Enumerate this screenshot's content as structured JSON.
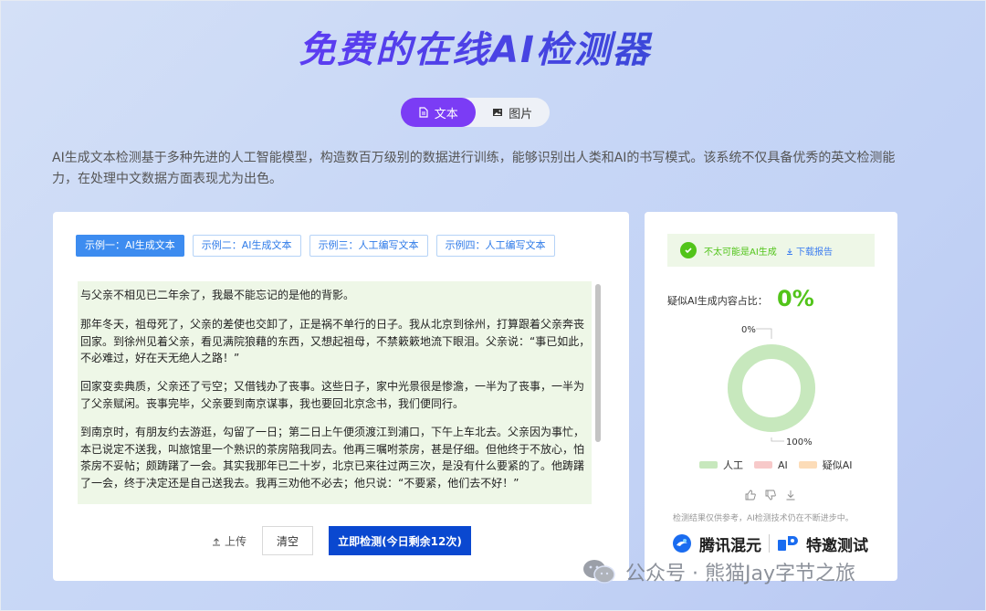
{
  "header": {
    "title": "免费的在线AI检测器"
  },
  "mode_tabs": [
    {
      "label": "文本",
      "icon": "document-icon",
      "active": true
    },
    {
      "label": "图片",
      "icon": "image-icon",
      "active": false
    }
  ],
  "intro_text": "AI生成文本检测基于多种先进的人工智能模型，构造数百万级别的数据进行训练，能够识别出人类和AI的书写模式。该系统不仅具备优秀的英文检测能力，在处理中文数据方面表现尤为出色。",
  "examples": [
    {
      "label": "示例一：AI生成文本",
      "active": true
    },
    {
      "label": "示例二：AI生成文本",
      "active": false
    },
    {
      "label": "示例三：人工编写文本",
      "active": false
    },
    {
      "label": "示例四：人工编写文本",
      "active": false
    }
  ],
  "input_text": {
    "p1": "与父亲不相见已二年余了，我最不能忘记的是他的背影。",
    "p2": "那年冬天，祖母死了，父亲的差使也交卸了，正是祸不单行的日子。我从北京到徐州，打算跟着父亲奔丧回家。到徐州见着父亲，看见满院狼藉的东西，又想起祖母，不禁簌簌地流下眼泪。父亲说：“事已如此，不必难过，好在天无绝人之路！”",
    "p3": "回家变卖典质，父亲还了亏空；又借钱办了丧事。这些日子，家中光景很是惨澹，一半为了丧事，一半为了父亲赋闲。丧事完毕，父亲要到南京谋事，我也要回北京念书，我们便同行。",
    "p4": "到南京时，有朋友约去游逛，勾留了一日；第二日上午便须渡江到浦口，下午上车北去。父亲因为事忙，本已说定不送我，叫旅馆里一个熟识的茶房陪我同去。他再三嘱咐茶房，甚是仔细。但他终于不放心，怕茶房不妥帖；颇踌躇了一会。其实我那年已二十岁，北京已来往过两三次，是没有什么要紧的了。他踌躇了一会，终于决定还是自己送我去。我再三劝他不必去；他只说：“不要紧，他们去不好！”"
  },
  "actions": {
    "upload_label": "上传",
    "clear_label": "清空",
    "detect_label": "立即检测(今日剩余12次)"
  },
  "result": {
    "status_text": "不太可能是AI生成",
    "download_label": "下载报告",
    "ratio_label": "疑似AI生成内容占比：",
    "ratio_value": "0%",
    "disclaimer": "检测结果仅供参考，AI检测技术仍在不断进步中。"
  },
  "chart_data": {
    "type": "pie",
    "categories": [
      "人工",
      "AI",
      "疑似AI"
    ],
    "values": [
      100,
      0,
      0
    ],
    "annotations": [
      "0%",
      "100%"
    ],
    "colors": {
      "人工": "#c7e8bd",
      "AI": "#f7c9c9",
      "疑似AI": "#fcdcb8"
    },
    "legend": "bottom"
  },
  "brands": {
    "tencent": "腾讯混元",
    "tejiao": "特邀测试"
  },
  "watermark": "公众号 · 熊猫Jay字节之旅",
  "colors": {
    "accent": "#7b3cf5",
    "primary_button": "#0a48d0",
    "success": "#52c41a",
    "link": "#3d7ef0"
  }
}
